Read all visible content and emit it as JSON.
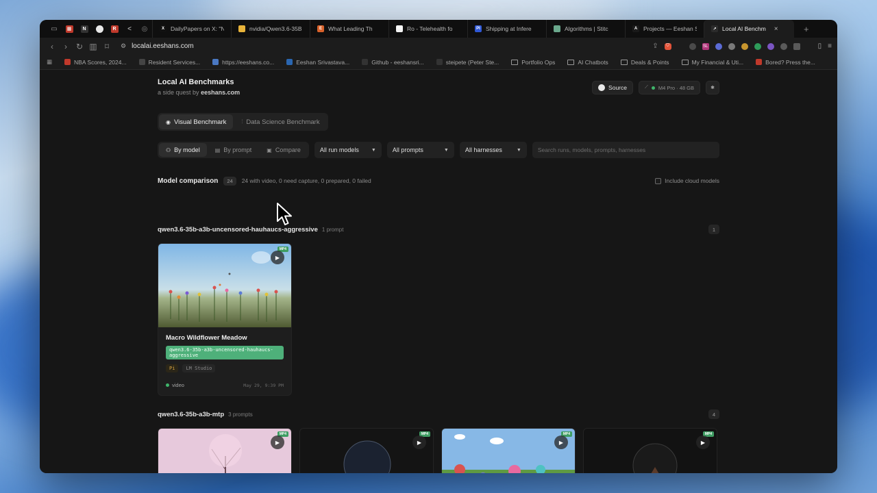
{
  "browser": {
    "tabs": [
      {
        "label": "DailyPapers on X: \"N",
        "color": "#111111",
        "glyph": "X"
      },
      {
        "label": "nvidia/Qwen3.6-35B",
        "color": "#e8b33a",
        "glyph": ""
      },
      {
        "label": "What Leading Th",
        "color": "#d9622b",
        "glyph": "E"
      },
      {
        "label": "Ro - Telehealth fo",
        "color": "#f2f2f2",
        "glyph": "RO"
      },
      {
        "label": "Shipping at Infere",
        "color": "#2f58d6",
        "glyph": "PI"
      },
      {
        "label": "Algorithms | Stitc",
        "color": "#6aa88c",
        "glyph": ""
      },
      {
        "label": "Projects — Eeshan S",
        "color": "#1a1a1a",
        "glyph": "A"
      },
      {
        "label": "Local AI Benchm",
        "color": "#2b2b2b",
        "glyph": "↗",
        "active": true
      }
    ],
    "url": "localai.eeshans.com",
    "bookmarks": [
      {
        "label": "NBA Scores, 2024...",
        "type": "site",
        "color": "#c0392b"
      },
      {
        "label": "Resident Services...",
        "type": "site",
        "color": "#444444"
      },
      {
        "label": "https://eeshans.co...",
        "type": "site",
        "color": "#4a78c2"
      },
      {
        "label": "Eeshan Srivastava...",
        "type": "site",
        "color": "#2a66b0"
      },
      {
        "label": "Github - eeshansri...",
        "type": "site",
        "color": "#333333"
      },
      {
        "label": "steipete (Peter Ste...",
        "type": "site",
        "color": "#333333"
      },
      {
        "label": "Portfolio Ops",
        "type": "folder"
      },
      {
        "label": "AI Chatbots",
        "type": "folder"
      },
      {
        "label": "Deals & Points",
        "type": "folder"
      },
      {
        "label": "My Financial & Uti...",
        "type": "folder"
      },
      {
        "label": "Bored? Press the...",
        "type": "site",
        "color": "#c0392b"
      }
    ]
  },
  "site": {
    "title": "Local AI Benchmarks",
    "subtitle_prefix": "a side quest by",
    "subtitle_link": "eeshans.com",
    "source_label": "Source",
    "hardware_label": "M4 Pro · 48 GB",
    "theme_icon": "star-icon"
  },
  "bench_tabs": [
    {
      "label": "Visual Benchmark",
      "icon": "eye-icon",
      "active": true
    },
    {
      "label": "Data Science Benchmark",
      "icon": "chart-icon",
      "active": false
    }
  ],
  "view_tabs": [
    {
      "label": "By model",
      "icon": "model-icon",
      "active": true
    },
    {
      "label": "By prompt",
      "icon": "prompt-icon",
      "active": false
    },
    {
      "label": "Compare",
      "icon": "compare-icon",
      "active": false
    }
  ],
  "filters": {
    "run_models": "All run models",
    "prompts": "All prompts",
    "harnesses": "All harnesses",
    "search_placeholder": "Search runs, models, prompts, harnesses"
  },
  "comparison": {
    "title": "Model comparison",
    "count": "24",
    "stats": "24 with video, 0 need capture, 0 prepared, 0 failed",
    "cloud_label": "Include cloud models"
  },
  "groups": [
    {
      "name": "qwen3.6-35b-a3b-uncensored-hauhaucs-aggressive",
      "prompt_count": "1 prompt",
      "num": "1",
      "card": {
        "title": "Macro Wildflower Meadow",
        "model_tag": "qwen3.6-35b-a3b-uncensored-hauhaucs-aggressive",
        "harness": "Pi",
        "runtime": "LM Studio",
        "status": "video",
        "date": "May 29, 9:39 PM",
        "badge": "MP4"
      }
    },
    {
      "name": "qwen3.6-35b-a3b-mtp",
      "prompt_count": "3 prompts",
      "num": "4",
      "badge": "MP4"
    }
  ]
}
